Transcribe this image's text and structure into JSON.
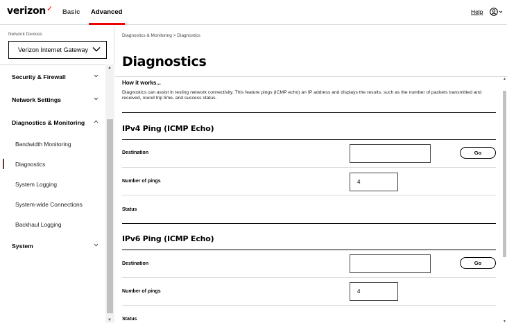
{
  "header": {
    "logo": "verizon",
    "logo_mark": "✓",
    "tabs": [
      "Basic",
      "Advanced"
    ],
    "active_tab": "Advanced",
    "help": "Help"
  },
  "sidebar": {
    "device_label": "Network Devices",
    "device_value": "Verizon Internet Gateway",
    "items": [
      {
        "label": "Security & Firewall"
      },
      {
        "label": "Network Settings"
      },
      {
        "label": "Diagnostics & Monitoring"
      },
      {
        "label": "System"
      }
    ],
    "subitems": [
      {
        "label": "Bandwidth Monitoring"
      },
      {
        "label": "Diagnostics"
      },
      {
        "label": "System Logging"
      },
      {
        "label": "System-wide Connections"
      },
      {
        "label": "Backhaul Logging"
      }
    ],
    "active_subitem": "Diagnostics"
  },
  "main": {
    "breadcrumb": "Diagnostics & Monitoring  >  Diagnostics",
    "title": "Diagnostics",
    "how_title": "How it works...",
    "how_text": "Diagnostics can assist in testing network connectivity. This feature pings (ICMP echo) an IP address and displays the results, such as the number of packets transmitted and received, round trip time, and success status.",
    "ipv4": {
      "title": "IPv4 Ping (ICMP Echo)",
      "destination_label": "Destination",
      "destination_value": "",
      "go": "Go",
      "pings_label": "Number of pings",
      "pings_value": "4",
      "status_label": "Status"
    },
    "ipv6": {
      "title": "IPv6 Ping (ICMP Echo)",
      "destination_label": "Destination",
      "destination_value": "",
      "go": "Go",
      "pings_label": "Number of pings",
      "pings_value": "4",
      "status_label": "Status"
    }
  },
  "colors": {
    "accent": "#ee0000",
    "border": "#d8dada",
    "scroll_thumb": "#c1c1c1"
  }
}
